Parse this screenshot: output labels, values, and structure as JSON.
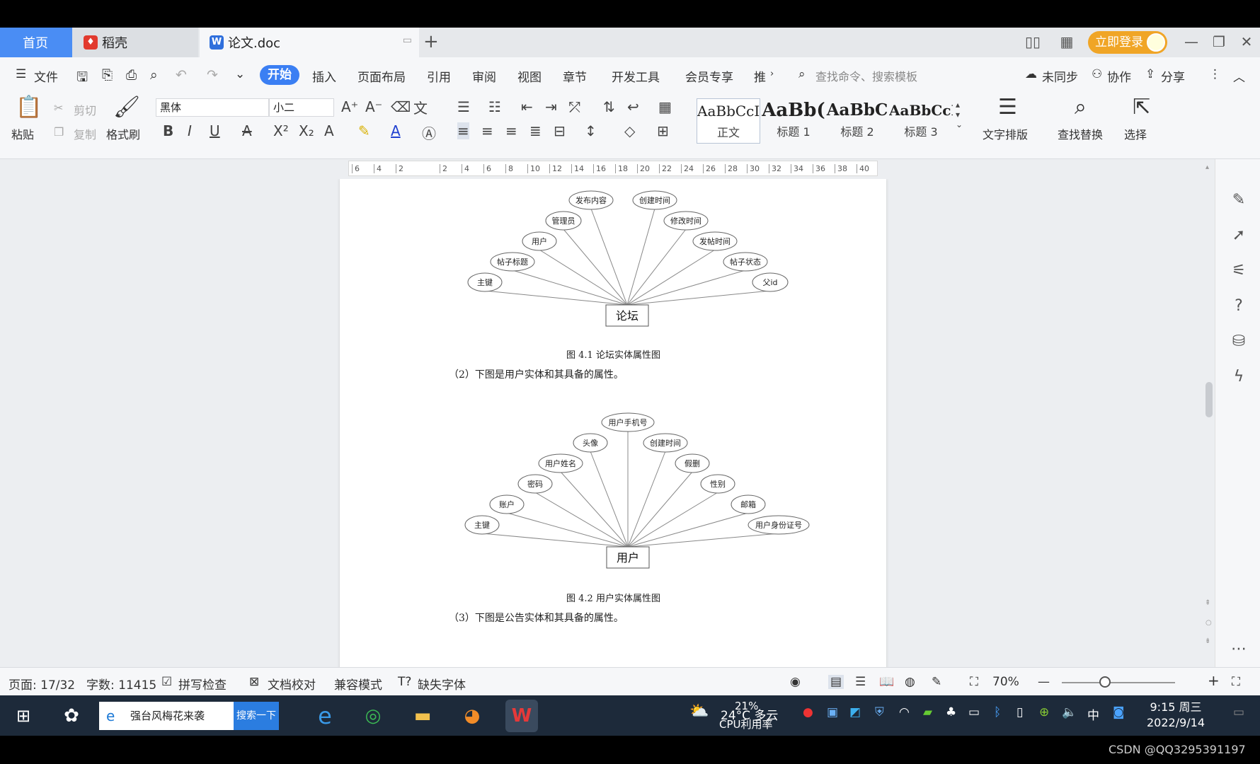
{
  "tabs": {
    "home": "首页",
    "daoke": "稻壳",
    "doc": "论文.doc"
  },
  "header": {
    "login": "立即登录"
  },
  "menu": {
    "file": "文件",
    "start": "开始",
    "insert": "插入",
    "layout": "页面布局",
    "ref": "引用",
    "review": "审阅",
    "view": "视图",
    "chapter": "章节",
    "dev": "开发工具",
    "member": "会员专享",
    "more": "推",
    "search_placeholder": "查找命令、搜索模板",
    "unsynced": "未同步",
    "collab": "协作",
    "share": "分享"
  },
  "ribbon": {
    "paste": "粘贴",
    "cut": "剪切",
    "copy": "复制",
    "format_painter": "格式刷",
    "font_name": "黑体",
    "font_size": "小二",
    "styles": [
      {
        "preview": "AaBbCcI",
        "name": "正文"
      },
      {
        "preview": "AaBb(",
        "name": "标题 1"
      },
      {
        "preview": "AaBbC",
        "name": "标题 2"
      },
      {
        "preview": "AaBbCcI",
        "name": "标题 3"
      }
    ],
    "text_layout": "文字排版",
    "find_replace": "查找替换",
    "select": "选择"
  },
  "ruler_ticks": [
    "6",
    "4",
    "2",
    "",
    "2",
    "4",
    "6",
    "8",
    "10",
    "12",
    "14",
    "16",
    "18",
    "20",
    "22",
    "24",
    "26",
    "28",
    "30",
    "32",
    "34",
    "36",
    "38",
    "40"
  ],
  "document": {
    "diagram1": {
      "entity": "论坛",
      "attributes": [
        "主键",
        "帖子标题",
        "用户",
        "管理员",
        "发布内容",
        "创建时间",
        "修改时间",
        "发帖时间",
        "帖子状态",
        "父id"
      ],
      "caption": "图 4.1 论坛实体属性图"
    },
    "para2": "（2）下图是用户实体和其具备的属性。",
    "diagram2": {
      "entity": "用户",
      "attributes": [
        "主键",
        "账户",
        "密码",
        "用户姓名",
        "头像",
        "用户手机号",
        "创建时间",
        "假删",
        "性别",
        "邮箱",
        "用户身份证号"
      ],
      "caption": "图 4.2 用户实体属性图"
    },
    "para3": "（3）下图是公告实体和其具备的属性。"
  },
  "status": {
    "page": "页面: 17/32",
    "words": "字数: 11415",
    "spell": "拼写检查",
    "proof": "文档校对",
    "compat": "兼容模式",
    "missing_font": "缺失字体",
    "zoom": "70%"
  },
  "taskbar": {
    "search_text": "强台风梅花来袭",
    "search_btn": "搜索一下",
    "weather": "24°C 多云",
    "cpu": "21%",
    "cpu_label": "CPU利用率",
    "ime": "中",
    "time": "9:15 周三",
    "date": "2022/9/14"
  },
  "watermark": "CSDN @QQ3295391197"
}
